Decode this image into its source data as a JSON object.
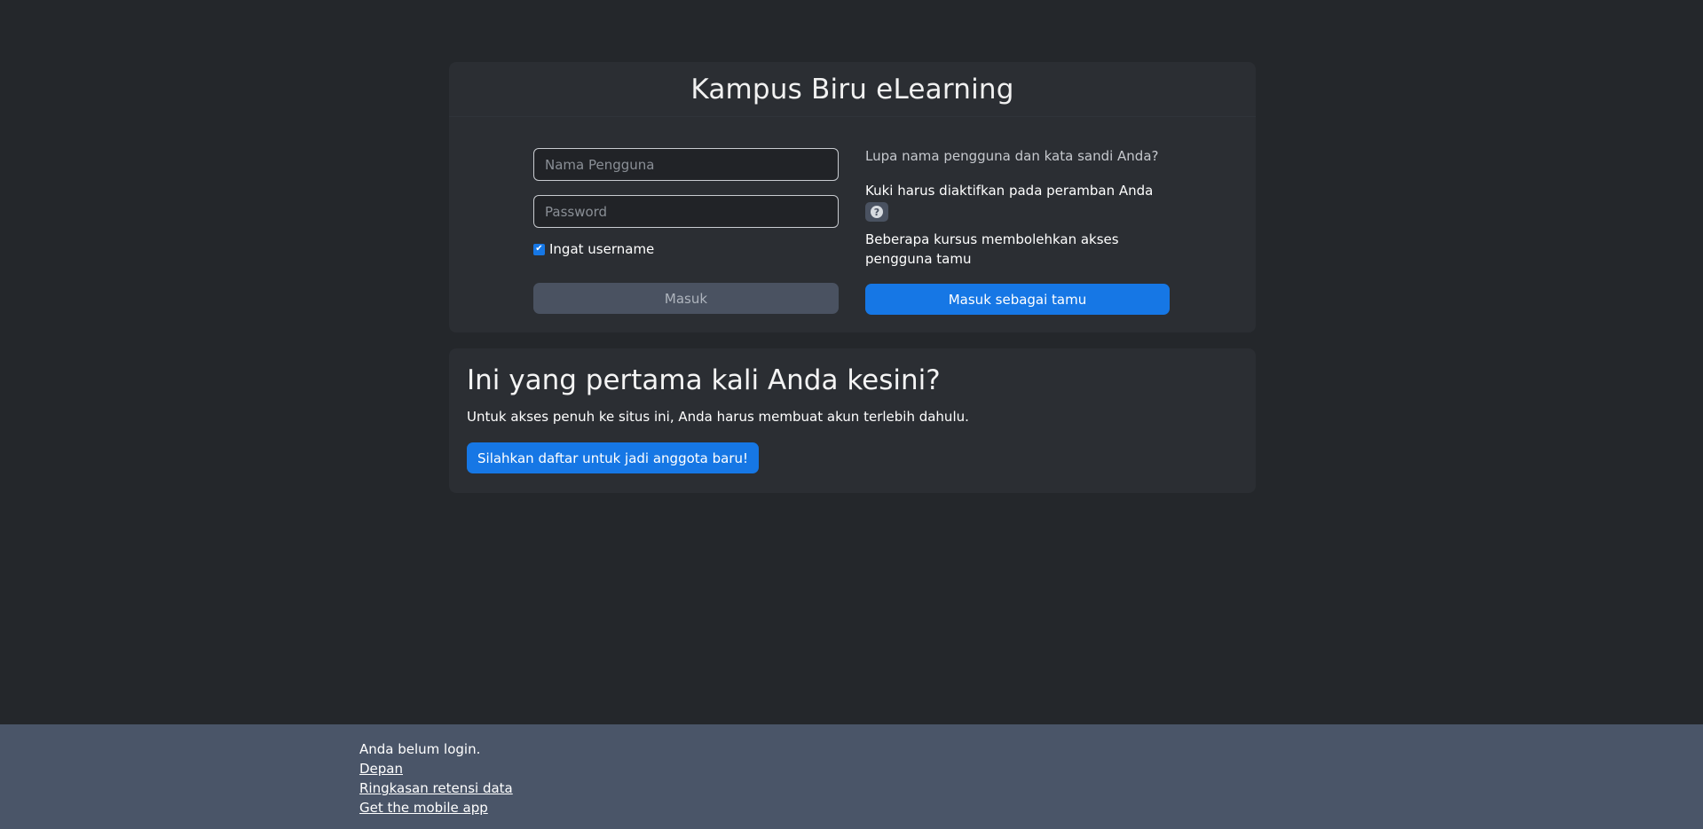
{
  "login": {
    "title": "Kampus Biru eLearning",
    "username_placeholder": "Nama Pengguna",
    "password_placeholder": "Password",
    "remember_label": "Ingat username",
    "remember_checked": true,
    "login_button": "Masuk",
    "forgot_link": "Lupa nama pengguna dan kata sandi Anda?",
    "cookie_notice": "Kuki harus diaktifkan pada peramban Anda",
    "guest_note": "Beberapa kursus membolehkan akses pengguna tamu",
    "guest_button": "Masuk sebagai tamu"
  },
  "signup": {
    "heading": "Ini yang pertama kali Anda kesini?",
    "text": "Untuk akses penuh ke situs ini, Anda harus membuat akun terlebih dahulu.",
    "button": "Silahkan daftar untuk jadi anggota baru!"
  },
  "footer": {
    "status": "Anda belum login.",
    "links": [
      "Depan",
      "Ringkasan retensi data",
      "Get the mobile app"
    ]
  },
  "colors": {
    "background": "#24272b",
    "card": "#2b2e33",
    "primary": "#1677e5",
    "footer": "#4a5568",
    "disabled_button": "#4a5261"
  },
  "icons": {
    "help": "question-circle-icon",
    "checkbox": "check-icon"
  }
}
